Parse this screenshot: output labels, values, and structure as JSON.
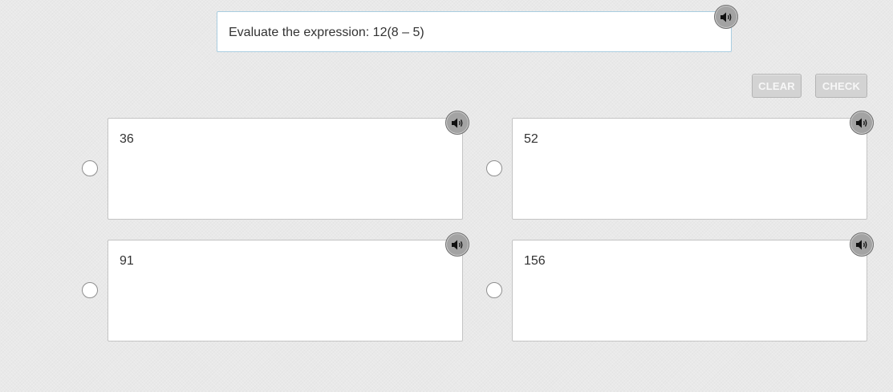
{
  "question": {
    "text": "Evaluate the expression: 12(8 – 5)",
    "audio_icon": "speaker-icon"
  },
  "actions": {
    "clear_label": "CLEAR",
    "check_label": "CHECK"
  },
  "options": [
    {
      "text": "36",
      "audio_icon": "speaker-icon",
      "selected": false
    },
    {
      "text": "52",
      "audio_icon": "speaker-icon",
      "selected": false
    },
    {
      "text": "91",
      "audio_icon": "speaker-icon",
      "selected": false
    },
    {
      "text": "156",
      "audio_icon": "speaker-icon",
      "selected": false
    }
  ],
  "colors": {
    "background": "#e9e9e9",
    "card": "#ffffff",
    "question_border": "#a9cde0",
    "speaker_button": "#a3a3a3",
    "disabled_button": "#d3d3d3"
  }
}
